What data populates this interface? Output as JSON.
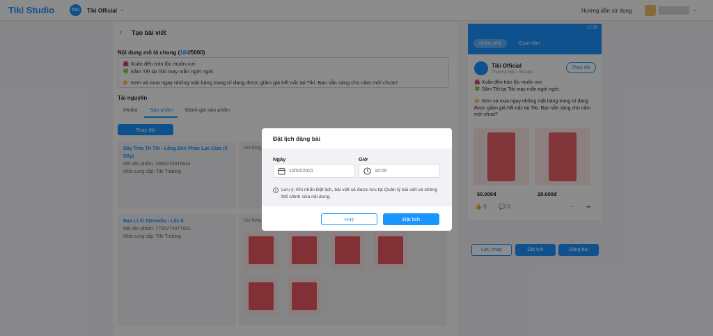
{
  "topbar": {
    "logo": "Tiki Studio",
    "shop_avatar": "TIKI",
    "shop_name": "Tiki Official",
    "guide_link": "Hướng dẫn sử dụng"
  },
  "editor": {
    "title": "Tạo bài viết",
    "desc_label": "Nội dung mô tả chung",
    "char_count": "184",
    "char_max": "/5000",
    "desc_lines": [
      "🌺 Xuân đến tràn lộc muôn nơi",
      "🍀 Sắm Tết tại Tiki may mắn ngời ngời.",
      "👉 Xem và mua ngay những mặt hàng trang trí đang được giảm giá hết nấc tại Tiki. Bạn sẵn sàng cho năm mới chưa?"
    ],
    "resources_label": "Tài nguyên",
    "tabs": [
      "Media",
      "Sản phẩm",
      "Đánh giá sản phẩm"
    ],
    "change_button": "Thay đổi",
    "products": [
      {
        "name": "Dây Treo Trí Tết - Lồng Đèn Pháo Lục Giác (5 Dây)",
        "code": "Mã sản phẩm: 2880215318644",
        "supplier": "Nhà cung cấp: Tiki Trading",
        "media_label": "Vui lòng"
      },
      {
        "name": "Bao Lì Xì SDmedia - Lốc 8",
        "code": "Mã sản phẩm: 7700774077651",
        "supplier": "Nhà cung cấp: Tiki Trading",
        "media_label": "Vui lòng"
      }
    ]
  },
  "preview": {
    "status_time": "12:30",
    "tab_active": "Khám phá",
    "tab_other": "Quan tâm",
    "shop_name": "Tiki Official",
    "shop_sub": "Thương hiệu · Bài gốc",
    "follow_button": "Theo dõi",
    "text_lines": [
      "🌺 Xuân đến tràn lộc muôn nơi",
      "🍀 Sắm Tết tại Tiki may mắn ngời ngời.",
      "👉 Xem và mua ngay những mặt hàng trang trí đang được giảm giá hết nấc tại Tiki. Bạn sẵn sàng cho năm mới chưa?"
    ],
    "price_1": "60.000đ",
    "price_2": "28.600đ",
    "like_count": "0",
    "comment_count": "0"
  },
  "footer": {
    "save_draft": "Lưu nháp",
    "schedule": "Đặt lịch",
    "publish": "Đăng bài"
  },
  "modal": {
    "title": "Đặt lịch đăng bài",
    "date_label": "Ngày",
    "date_value": "10/02/2021",
    "time_label": "Giờ",
    "time_value": "10:00",
    "note": "Lưu ý: Khi nhấn Đặt lịch, bài viết sẽ được lưu tại Quản lý bài viết và không thể chỉnh sửa nội dung.",
    "cancel_button": "Huỷ",
    "confirm_button": "Đặt lịch"
  }
}
